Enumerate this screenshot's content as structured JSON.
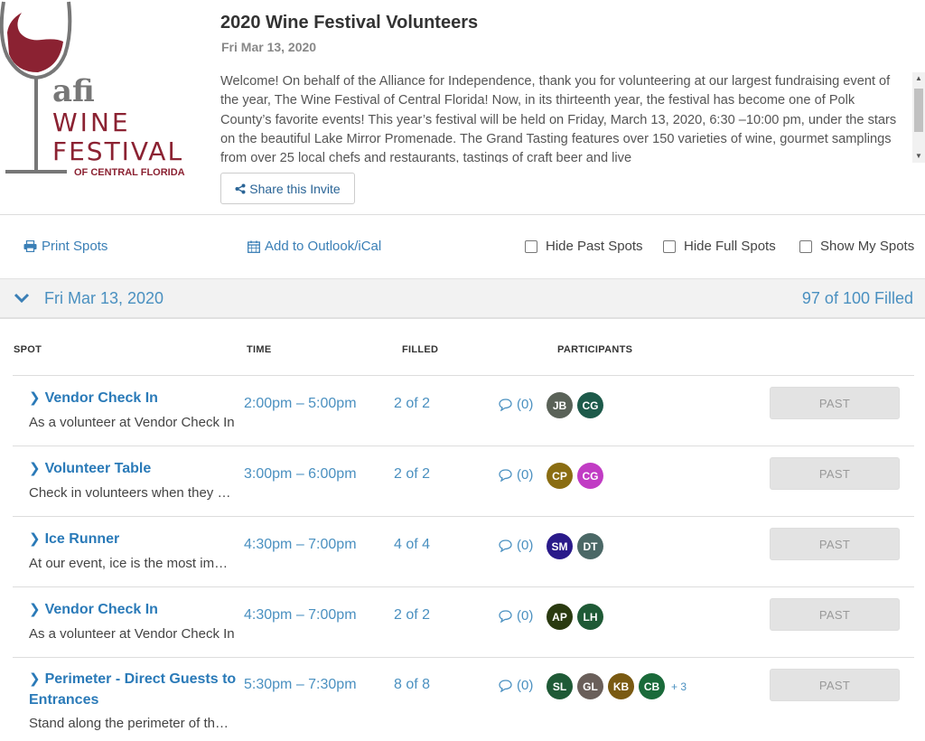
{
  "event": {
    "title": "2020 Wine Festival Volunteers",
    "date": "Fri Mar 13, 2020",
    "description": "Welcome! On behalf of the Alliance for Independence, thank you for volunteering at our largest fundraising event of the year, The Wine Festival of Central Florida! Now, in its thirteenth year, the festival has become one of Polk County’s favorite events! This year’s festival will be held on Friday, March 13, 2020, 6:30 –10:00 pm, under the stars on the beautiful Lake Mirror Promenade. The Grand Tasting features over 150 varieties of wine, gourmet samplings from over 25 local chefs and restaurants, tastings of craft beer and live",
    "share_label": "Share this Invite"
  },
  "logo": {
    "line1": "afi",
    "line2": "WINE",
    "line3": "FESTIVAL",
    "line4": "OF CENTRAL FLORIDA",
    "accent_color": "#8b2232"
  },
  "toolbar": {
    "print_label": "Print Spots",
    "calendar_label": "Add to Outlook/iCal",
    "hide_past_label": "Hide Past Spots",
    "hide_full_label": "Hide Full Spots",
    "show_mine_label": "Show My Spots"
  },
  "date_bar": {
    "date": "Fri Mar 13, 2020",
    "filled": "97 of 100 Filled"
  },
  "table": {
    "headers": {
      "spot": "SPOT",
      "time": "TIME",
      "filled": "FILLED",
      "participants": "PARTICIPANTS"
    },
    "rows": [
      {
        "title": "Vendor Check In",
        "desc": "As a volunteer at Vendor Check In",
        "time": "2:00pm – 5:00pm",
        "filled": "2 of 2",
        "comments": "(0)",
        "participants": [
          {
            "initials": "JB",
            "color": "#5a6258"
          },
          {
            "initials": "CG",
            "color": "#1d5a4a"
          }
        ],
        "more": "",
        "status": "PAST"
      },
      {
        "title": "Volunteer Table",
        "desc": "Check in volunteers when they arrive",
        "time": "3:00pm – 6:00pm",
        "filled": "2 of 2",
        "comments": "(0)",
        "participants": [
          {
            "initials": "CP",
            "color": "#8a6d12"
          },
          {
            "initials": "CG",
            "color": "#c13cc4"
          }
        ],
        "more": "",
        "status": "PAST"
      },
      {
        "title": "Ice Runner",
        "desc": "At our event, ice is the most important",
        "time": "4:30pm – 7:00pm",
        "filled": "4 of 4",
        "comments": "(0)",
        "participants": [
          {
            "initials": "SM",
            "color": "#2a1a8a"
          },
          {
            "initials": "DT",
            "color": "#4b6866"
          }
        ],
        "more": "",
        "status": "PAST"
      },
      {
        "title": "Vendor Check In",
        "desc": "As a volunteer at Vendor Check In",
        "time": "4:30pm – 7:00pm",
        "filled": "2 of 2",
        "comments": "(0)",
        "participants": [
          {
            "initials": "AP",
            "color": "#2a3a10"
          },
          {
            "initials": "LH",
            "color": "#1f5a36"
          }
        ],
        "more": "",
        "status": "PAST"
      },
      {
        "title": "Perimeter - Direct Guests to Entrances",
        "desc": "Stand along the perimeter of the event",
        "time": "5:30pm – 7:30pm",
        "filled": "8 of 8",
        "comments": "(0)",
        "participants": [
          {
            "initials": "SL",
            "color": "#1f5a36"
          },
          {
            "initials": "GL",
            "color": "#6a5f5a"
          },
          {
            "initials": "KB",
            "color": "#7a5a12"
          },
          {
            "initials": "CB",
            "color": "#1a6a3a"
          }
        ],
        "more": "+ 3",
        "status": "PAST"
      }
    ]
  }
}
